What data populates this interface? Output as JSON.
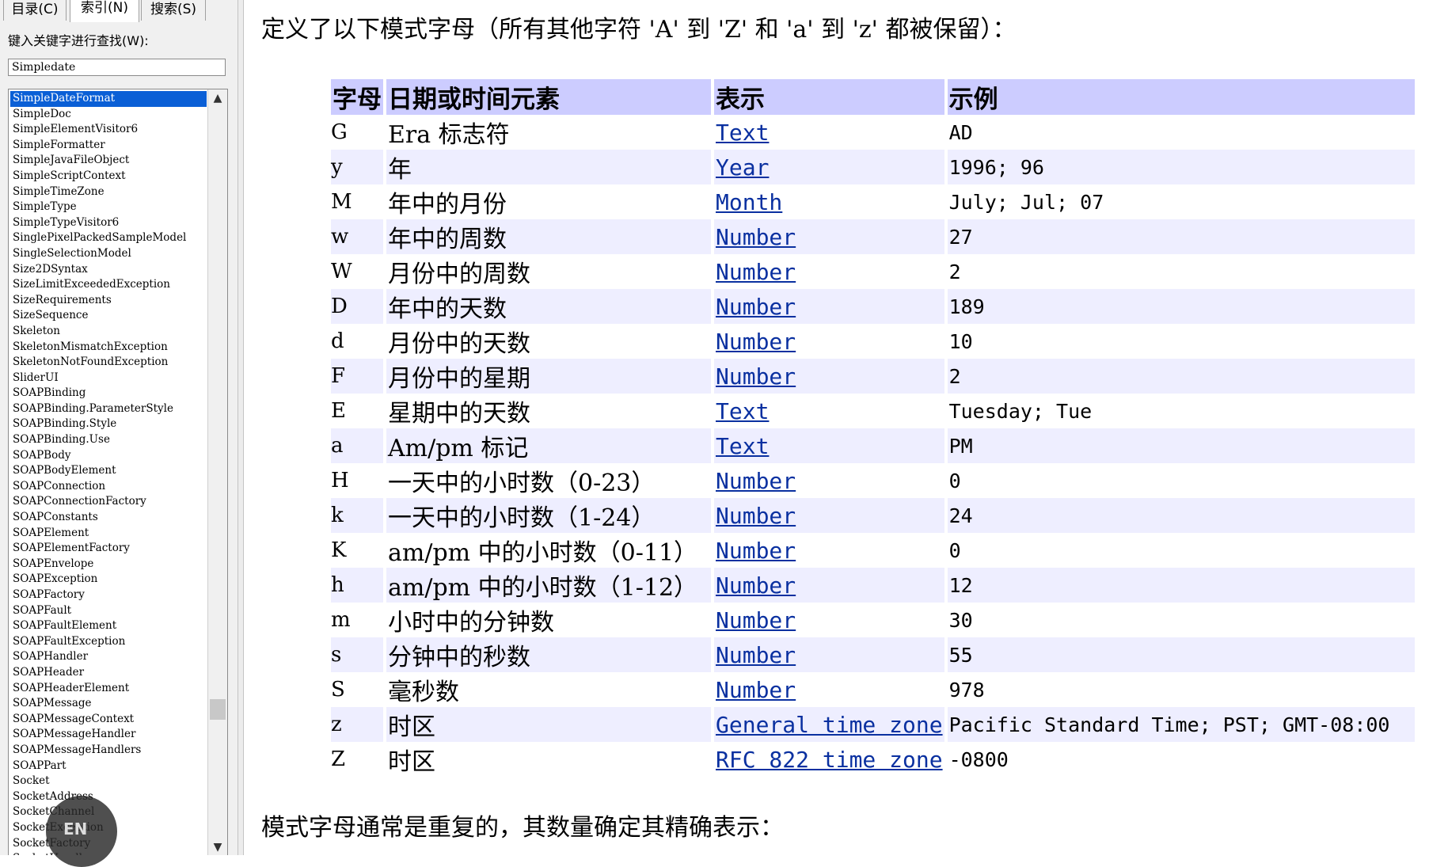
{
  "tabs": [
    "目录(C)",
    "索引(N)",
    "搜索(S)"
  ],
  "search": {
    "label": "键入关键字进行查找(W):",
    "value": "Simpledate"
  },
  "index_items": [
    "SimpleDateFormat",
    "SimpleDoc",
    "SimpleElementVisitor6",
    "SimpleFormatter",
    "SimpleJavaFileObject",
    "SimpleScriptContext",
    "SimpleTimeZone",
    "SimpleType",
    "SimpleTypeVisitor6",
    "SinglePixelPackedSampleModel",
    "SingleSelectionModel",
    "Size2DSyntax",
    "SizeLimitExceededException",
    "SizeRequirements",
    "SizeSequence",
    "Skeleton",
    "SkeletonMismatchException",
    "SkeletonNotFoundException",
    "SliderUI",
    "SOAPBinding",
    "SOAPBinding.ParameterStyle",
    "SOAPBinding.Style",
    "SOAPBinding.Use",
    "SOAPBody",
    "SOAPBodyElement",
    "SOAPConnection",
    "SOAPConnectionFactory",
    "SOAPConstants",
    "SOAPElement",
    "SOAPElementFactory",
    "SOAPEnvelope",
    "SOAPException",
    "SOAPFactory",
    "SOAPFault",
    "SOAPFaultElement",
    "SOAPFaultException",
    "SOAPHandler",
    "SOAPHeader",
    "SOAPHeaderElement",
    "SOAPMessage",
    "SOAPMessageContext",
    "SOAPMessageHandler",
    "SOAPMessageHandlers",
    "SOAPPart",
    "Socket",
    "SocketAddress",
    "SocketChannel",
    "SocketException",
    "SocketFactory",
    "SocketHandler"
  ],
  "selected_index": 0,
  "ime_badge": "EN",
  "content": {
    "intro": "定义了以下模式字母（所有其他字符 'A' 到 'Z' 和 'a' 到 'z' 都被保留）：",
    "headers": [
      "字母",
      "日期或时间元素",
      "表示",
      "示例"
    ],
    "rows": [
      {
        "letter": "G",
        "element": "Era 标志符",
        "presentation": "Text",
        "example": "AD"
      },
      {
        "letter": "y",
        "element": "年",
        "presentation": "Year",
        "example": "1996; 96"
      },
      {
        "letter": "M",
        "element": "年中的月份",
        "presentation": "Month",
        "example": "July; Jul; 07"
      },
      {
        "letter": "w",
        "element": "年中的周数",
        "presentation": "Number",
        "example": "27"
      },
      {
        "letter": "W",
        "element": "月份中的周数",
        "presentation": "Number",
        "example": "2"
      },
      {
        "letter": "D",
        "element": "年中的天数",
        "presentation": "Number",
        "example": "189"
      },
      {
        "letter": "d",
        "element": "月份中的天数",
        "presentation": "Number",
        "example": "10"
      },
      {
        "letter": "F",
        "element": "月份中的星期",
        "presentation": "Number",
        "example": "2"
      },
      {
        "letter": "E",
        "element": "星期中的天数",
        "presentation": "Text",
        "example": "Tuesday; Tue"
      },
      {
        "letter": "a",
        "element": "Am/pm 标记",
        "presentation": "Text",
        "example": "PM"
      },
      {
        "letter": "H",
        "element": "一天中的小时数（0-23）",
        "presentation": "Number",
        "example": "0"
      },
      {
        "letter": "k",
        "element": "一天中的小时数（1-24）",
        "presentation": "Number",
        "example": "24"
      },
      {
        "letter": "K",
        "element": "am/pm 中的小时数（0-11）",
        "presentation": "Number",
        "example": "0"
      },
      {
        "letter": "h",
        "element": "am/pm 中的小时数（1-12）",
        "presentation": "Number",
        "example": "12"
      },
      {
        "letter": "m",
        "element": "小时中的分钟数",
        "presentation": "Number",
        "example": "30"
      },
      {
        "letter": "s",
        "element": "分钟中的秒数",
        "presentation": "Number",
        "example": "55"
      },
      {
        "letter": "S",
        "element": "毫秒数",
        "presentation": "Number",
        "example": "978"
      },
      {
        "letter": "z",
        "element": "时区",
        "presentation": "General time zone",
        "example": "Pacific Standard Time; PST; GMT-08:00"
      },
      {
        "letter": "Z",
        "element": "时区",
        "presentation": "RFC 822 time zone",
        "example": "-0800"
      }
    ],
    "footer": "模式字母通常是重复的，其数量确定其精确表示："
  },
  "colors": {
    "header_bg": "#ccccff",
    "alt_row_bg": "#eeeeff",
    "link": "#0a30a0",
    "selection": "#0a5fd6"
  }
}
